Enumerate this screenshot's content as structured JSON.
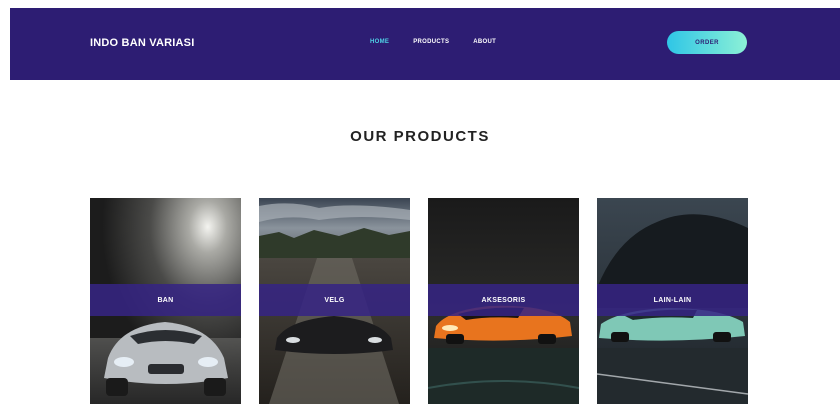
{
  "navbar": {
    "brand": "INDO BAN VARIASI",
    "links": [
      {
        "label": "HOME",
        "active": true
      },
      {
        "label": "PRODUCTS",
        "active": false
      },
      {
        "label": "ABOUT",
        "active": false
      }
    ],
    "cta_label": "ORDER"
  },
  "products": {
    "title": "OUR PRODUCTS",
    "cards": [
      {
        "label": "BAN",
        "image": "silver-sports-car-spotlight"
      },
      {
        "label": "VELG",
        "image": "dark-car-on-road"
      },
      {
        "label": "AKSESORIS",
        "image": "orange-sports-car-night"
      },
      {
        "label": "LAIN-LAIN",
        "image": "teal-car-cliff-road"
      }
    ]
  },
  "colors": {
    "nav_bg": "#2d1d73",
    "active_link": "#4fd2e6",
    "cta_gradient_start": "#2fc6e6",
    "cta_gradient_end": "#8cf0d6",
    "card_band": "#362484"
  }
}
